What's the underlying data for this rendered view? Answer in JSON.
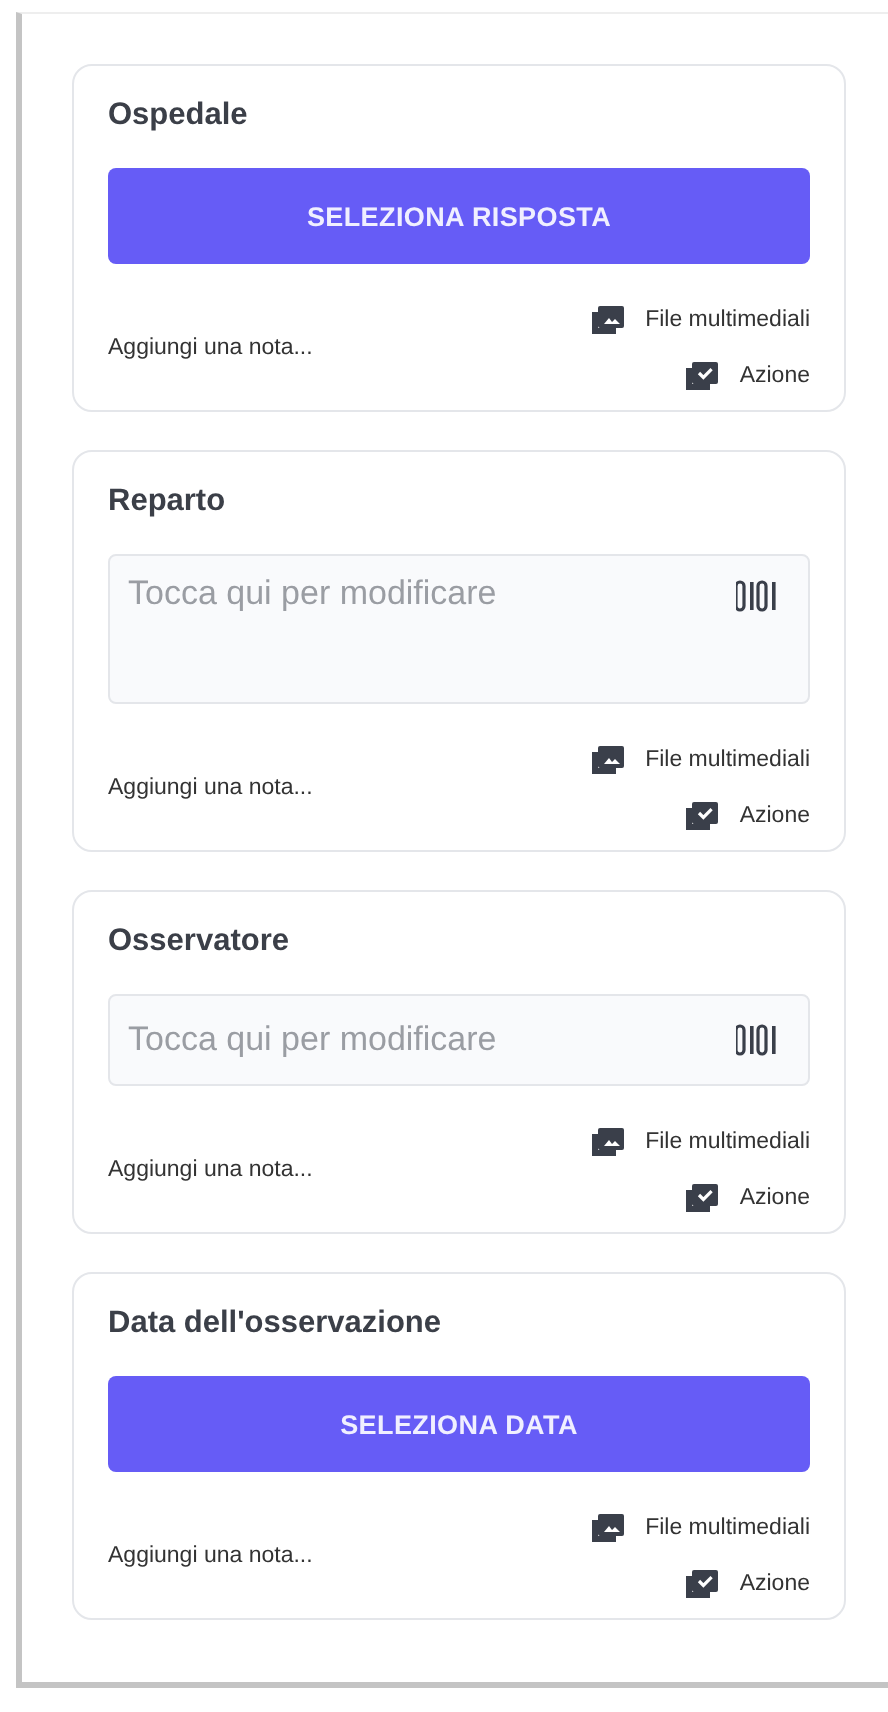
{
  "cards": [
    {
      "title": "Ospedale",
      "field": {
        "kind": "button",
        "label": "SELEZIONA RISPOSTA"
      },
      "note": "Aggiungi una nota...",
      "actions": [
        "File multimediali",
        "Azione"
      ]
    },
    {
      "title": "Reparto",
      "field": {
        "kind": "textarea",
        "placeholder": "Tocca qui per modificare"
      },
      "note": "Aggiungi una nota...",
      "actions": [
        "File multimediali",
        "Azione"
      ]
    },
    {
      "title": "Osservatore",
      "field": {
        "kind": "input",
        "placeholder": "Tocca qui per modificare"
      },
      "note": "Aggiungi una nota...",
      "actions": [
        "File multimediali",
        "Azione"
      ]
    },
    {
      "title": "Data dell'osservazione",
      "field": {
        "kind": "button",
        "label": "SELEZIONA DATA"
      },
      "note": "Aggiungi una nota...",
      "actions": [
        "File multimediali",
        "Azione"
      ]
    }
  ]
}
